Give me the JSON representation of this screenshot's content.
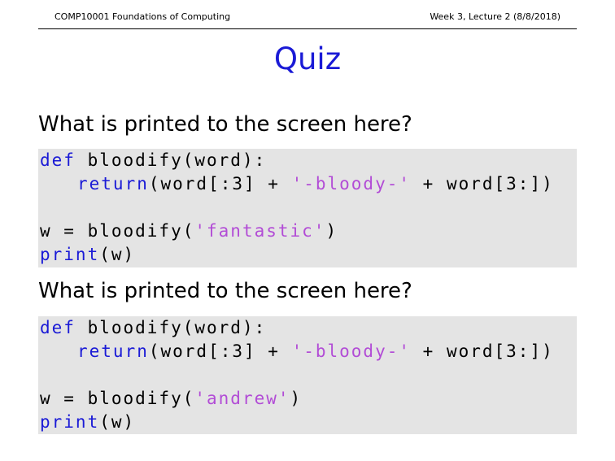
{
  "header": {
    "left": "COMP10001 Foundations of Computing",
    "right": "Week 3, Lecture 2 (8/8/2018)"
  },
  "title": "Quiz",
  "colors": {
    "title": "#1a1ad6",
    "keyword": "#1a1ad6",
    "string": "#b24cd6",
    "code_background": "#e4e4e4"
  },
  "questions": [
    {
      "prompt": "What is printed to the screen here?",
      "code": {
        "def_keyword": "def",
        "def_rest": " bloodify(word):",
        "return_keyword": "return",
        "return_pre": "(word[:3] + ",
        "return_string": "'-bloody-'",
        "return_post": " + word[3:])",
        "call_pre": "w = bloodify(",
        "call_string": "'fantastic'",
        "call_post": ")",
        "print_keyword": "print",
        "print_rest": "(w)"
      }
    },
    {
      "prompt": "What is printed to the screen here?",
      "code": {
        "def_keyword": "def",
        "def_rest": " bloodify(word):",
        "return_keyword": "return",
        "return_pre": "(word[:3] + ",
        "return_string": "'-bloody-'",
        "return_post": " + word[3:])",
        "call_pre": "w = bloodify(",
        "call_string": "'andrew'",
        "call_post": ")",
        "print_keyword": "print",
        "print_rest": "(w)"
      }
    }
  ]
}
